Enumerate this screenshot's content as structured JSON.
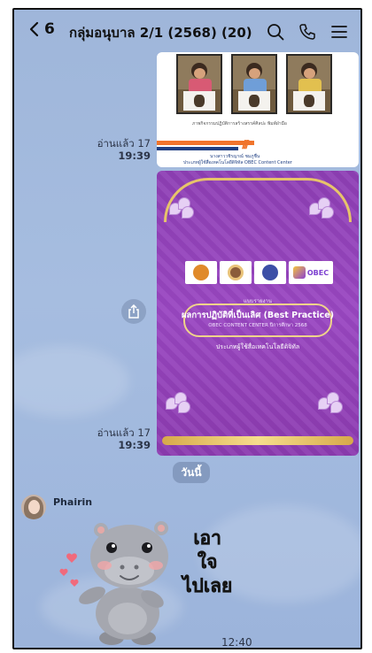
{
  "header": {
    "back_count": "6",
    "title": "กลุ่มอนุบาล 2/1 (2568) (20)",
    "icons": [
      "search-icon",
      "phone-icon",
      "menu-icon"
    ]
  },
  "messages": [
    {
      "read_label": "อ่านแล้ว 17",
      "time": "19:39",
      "card": {
        "caption": "ภาพกิจกรรมปฏิบัติการสร้างสรรค์ศิลปะ พิมพ์ฝ่ามือ",
        "footer_line1": "นางสาววชิรญาณ์ ชมภูชื่น",
        "footer_line2": "ประเภทผู้ใช้สื่อเทคโนโลยีดิจิทัล OBEC Content Center"
      }
    },
    {
      "read_label": "อ่านแล้ว 17",
      "time": "19:39",
      "card": {
        "logo_text": "OBEC",
        "logo_sub": "Content Center",
        "kicker": "แบบรายงาน",
        "title": "ผลการปฏิบัติที่เป็นเลิศ (Best Practice)",
        "subtitle": "OBEC CONTENT CENTER ปีการศึกษา 2568",
        "category": "ประเภทผู้ใช้สื่อเทคโนโลยีดิจิทัล"
      }
    }
  ],
  "date_separator": "วันนี้",
  "sticker_message": {
    "sender": "Phairin",
    "sticker_text": "เอา\nใจ\nไปเลย",
    "time": "12:40"
  },
  "colors": {
    "chat_bg": "#a3bbdf",
    "card_purple": "#9243bb",
    "gold": "#e7c46a",
    "accent_orange": "#f0742c"
  }
}
